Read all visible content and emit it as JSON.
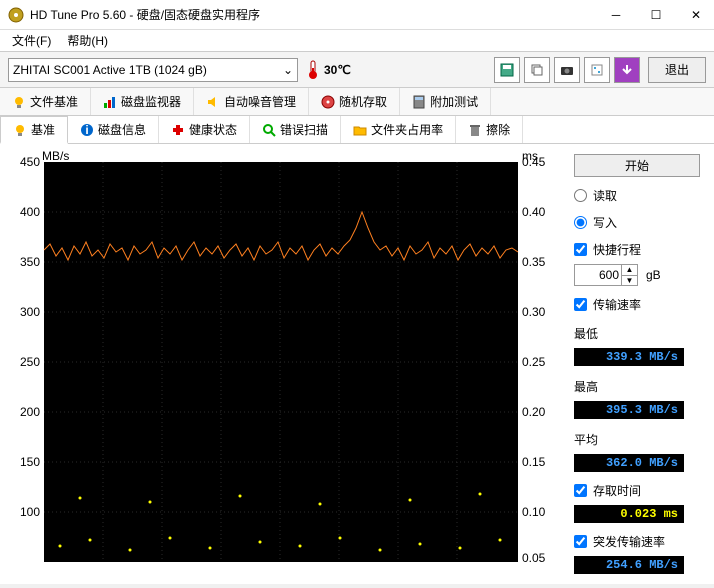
{
  "window": {
    "title": "HD Tune Pro 5.60 - 硬盘/固态硬盘实用程序"
  },
  "menu": {
    "file": "文件(F)",
    "help": "帮助(H)"
  },
  "toolbar": {
    "drive": "ZHITAI SC001 Active 1TB (1024 gB)",
    "temp": "30℃",
    "exit": "退出"
  },
  "tabs_top": {
    "file_base": "文件基准",
    "disk_monitor": "磁盘监视器",
    "aam": "自动噪音管理",
    "random": "随机存取",
    "extra": "附加测试"
  },
  "tabs_bottom": {
    "base": "基准",
    "info": "磁盘信息",
    "health": "健康状态",
    "error": "错误扫描",
    "folder": "文件夹占用率",
    "erase": "擦除"
  },
  "chart": {
    "y_left_label": "MB/s",
    "y_right_label": "ms",
    "y_left_max": "450",
    "y_left_400": "400",
    "y_left_350": "350",
    "y_left_300": "300",
    "y_left_250": "250",
    "y_left_200": "200",
    "y_left_150": "150",
    "y_left_100": "100",
    "y_right_45": "0.45",
    "y_right_40": "0.40",
    "y_right_35": "0.35",
    "y_right_30": "0.30",
    "y_right_25": "0.25",
    "y_right_20": "0.20",
    "y_right_15": "0.15",
    "y_right_10": "0.10",
    "y_right_05": "0.05"
  },
  "side": {
    "start": "开始",
    "read": "读取",
    "write": "写入",
    "short_stroke": "快捷行程",
    "short_stroke_val": "600",
    "short_stroke_unit": "gB",
    "transfer_rate": "传输速率",
    "min_label": "最低",
    "min_val": "339.3 MB/s",
    "max_label": "最高",
    "max_val": "395.3 MB/s",
    "avg_label": "平均",
    "avg_val": "362.0 MB/s",
    "access_time": "存取时间",
    "access_val": "0.023 ms",
    "burst": "突发传输速率",
    "burst_val": "254.6 MB/s"
  },
  "chart_data": {
    "type": "line",
    "title": "",
    "xlabel": "",
    "ylabel": "MB/s",
    "ylim": [
      100,
      450
    ],
    "y2label": "ms",
    "y2lim": [
      0.05,
      0.45
    ],
    "series": [
      {
        "name": "transfer",
        "unit": "MB/s",
        "approx_range": [
          339,
          395
        ],
        "avg": 362
      },
      {
        "name": "access",
        "unit": "ms",
        "avg": 0.023
      }
    ]
  }
}
